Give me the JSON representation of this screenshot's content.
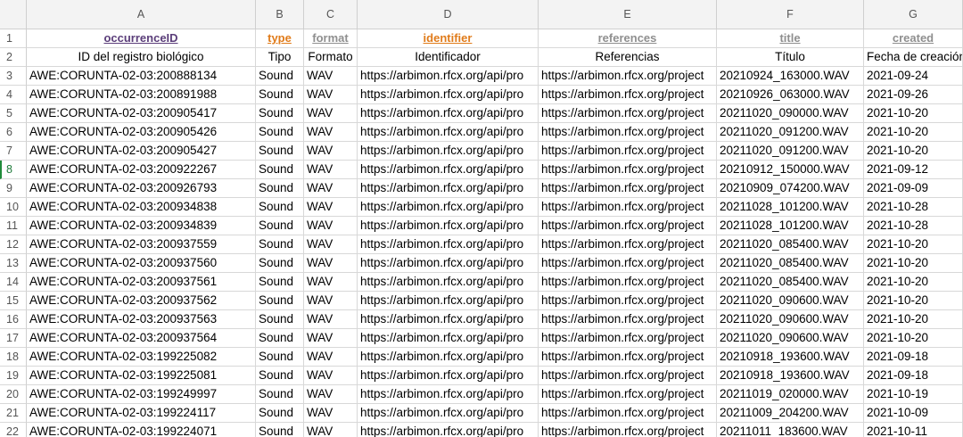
{
  "columns": [
    "A",
    "B",
    "C",
    "D",
    "E",
    "F",
    "G"
  ],
  "row_numbers": [
    "1",
    "2",
    "3",
    "4",
    "5",
    "6",
    "7",
    "8",
    "9",
    "10",
    "11",
    "12",
    "13",
    "14",
    "15",
    "16",
    "17",
    "18",
    "19",
    "20",
    "21",
    "22"
  ],
  "row1": [
    "occurrenceID",
    "type",
    "format",
    "identifier",
    "references",
    "title",
    "created"
  ],
  "row2": [
    "ID del registro biológico",
    "Tipo",
    "Formato",
    "Identificador",
    "Referencias",
    "Título",
    "Fecha de creación"
  ],
  "colors": {
    "purple": "#5b3e7a",
    "orange": "#e07b1a",
    "gray": "#8f8f8f",
    "active_row": "#1f7a3a"
  },
  "active_row": "8",
  "rows": [
    [
      "AWE:CORUNTA-02-03:200888134",
      "Sound",
      "WAV",
      "https://arbimon.rfcx.org/api/pro",
      "https://arbimon.rfcx.org/project",
      "20210924_163000.WAV",
      "2021-09-24"
    ],
    [
      "AWE:CORUNTA-02-03:200891988",
      "Sound",
      "WAV",
      "https://arbimon.rfcx.org/api/pro",
      "https://arbimon.rfcx.org/project",
      "20210926_063000.WAV",
      "2021-09-26"
    ],
    [
      "AWE:CORUNTA-02-03:200905417",
      "Sound",
      "WAV",
      "https://arbimon.rfcx.org/api/pro",
      "https://arbimon.rfcx.org/project",
      "20211020_090000.WAV",
      "2021-10-20"
    ],
    [
      "AWE:CORUNTA-02-03:200905426",
      "Sound",
      "WAV",
      "https://arbimon.rfcx.org/api/pro",
      "https://arbimon.rfcx.org/project",
      "20211020_091200.WAV",
      "2021-10-20"
    ],
    [
      "AWE:CORUNTA-02-03:200905427",
      "Sound",
      "WAV",
      "https://arbimon.rfcx.org/api/pro",
      "https://arbimon.rfcx.org/project",
      "20211020_091200.WAV",
      "2021-10-20"
    ],
    [
      "AWE:CORUNTA-02-03:200922267",
      "Sound",
      "WAV",
      "https://arbimon.rfcx.org/api/pro",
      "https://arbimon.rfcx.org/project",
      "20210912_150000.WAV",
      "2021-09-12"
    ],
    [
      "AWE:CORUNTA-02-03:200926793",
      "Sound",
      "WAV",
      "https://arbimon.rfcx.org/api/pro",
      "https://arbimon.rfcx.org/project",
      "20210909_074200.WAV",
      "2021-09-09"
    ],
    [
      "AWE:CORUNTA-02-03:200934838",
      "Sound",
      "WAV",
      "https://arbimon.rfcx.org/api/pro",
      "https://arbimon.rfcx.org/project",
      "20211028_101200.WAV",
      "2021-10-28"
    ],
    [
      "AWE:CORUNTA-02-03:200934839",
      "Sound",
      "WAV",
      "https://arbimon.rfcx.org/api/pro",
      "https://arbimon.rfcx.org/project",
      "20211028_101200.WAV",
      "2021-10-28"
    ],
    [
      "AWE:CORUNTA-02-03:200937559",
      "Sound",
      "WAV",
      "https://arbimon.rfcx.org/api/pro",
      "https://arbimon.rfcx.org/project",
      "20211020_085400.WAV",
      "2021-10-20"
    ],
    [
      "AWE:CORUNTA-02-03:200937560",
      "Sound",
      "WAV",
      "https://arbimon.rfcx.org/api/pro",
      "https://arbimon.rfcx.org/project",
      "20211020_085400.WAV",
      "2021-10-20"
    ],
    [
      "AWE:CORUNTA-02-03:200937561",
      "Sound",
      "WAV",
      "https://arbimon.rfcx.org/api/pro",
      "https://arbimon.rfcx.org/project",
      "20211020_085400.WAV",
      "2021-10-20"
    ],
    [
      "AWE:CORUNTA-02-03:200937562",
      "Sound",
      "WAV",
      "https://arbimon.rfcx.org/api/pro",
      "https://arbimon.rfcx.org/project",
      "20211020_090600.WAV",
      "2021-10-20"
    ],
    [
      "AWE:CORUNTA-02-03:200937563",
      "Sound",
      "WAV",
      "https://arbimon.rfcx.org/api/pro",
      "https://arbimon.rfcx.org/project",
      "20211020_090600.WAV",
      "2021-10-20"
    ],
    [
      "AWE:CORUNTA-02-03:200937564",
      "Sound",
      "WAV",
      "https://arbimon.rfcx.org/api/pro",
      "https://arbimon.rfcx.org/project",
      "20211020_090600.WAV",
      "2021-10-20"
    ],
    [
      "AWE:CORUNTA-02-03:199225082",
      "Sound",
      "WAV",
      "https://arbimon.rfcx.org/api/pro",
      "https://arbimon.rfcx.org/project",
      "20210918_193600.WAV",
      "2021-09-18"
    ],
    [
      "AWE:CORUNTA-02-03:199225081",
      "Sound",
      "WAV",
      "https://arbimon.rfcx.org/api/pro",
      "https://arbimon.rfcx.org/project",
      "20210918_193600.WAV",
      "2021-09-18"
    ],
    [
      "AWE:CORUNTA-02-03:199249997",
      "Sound",
      "WAV",
      "https://arbimon.rfcx.org/api/pro",
      "https://arbimon.rfcx.org/project",
      "20211019_020000.WAV",
      "2021-10-19"
    ],
    [
      "AWE:CORUNTA-02-03:199224117",
      "Sound",
      "WAV",
      "https://arbimon.rfcx.org/api/pro",
      "https://arbimon.rfcx.org/project",
      "20211009_204200.WAV",
      "2021-10-09"
    ],
    [
      "AWE:CORUNTA-02-03:199224071",
      "Sound",
      "WAV",
      "https://arbimon.rfcx.org/api/pro",
      "https://arbimon.rfcx.org/project",
      "20211011_183600.WAV",
      "2021-10-11"
    ]
  ]
}
